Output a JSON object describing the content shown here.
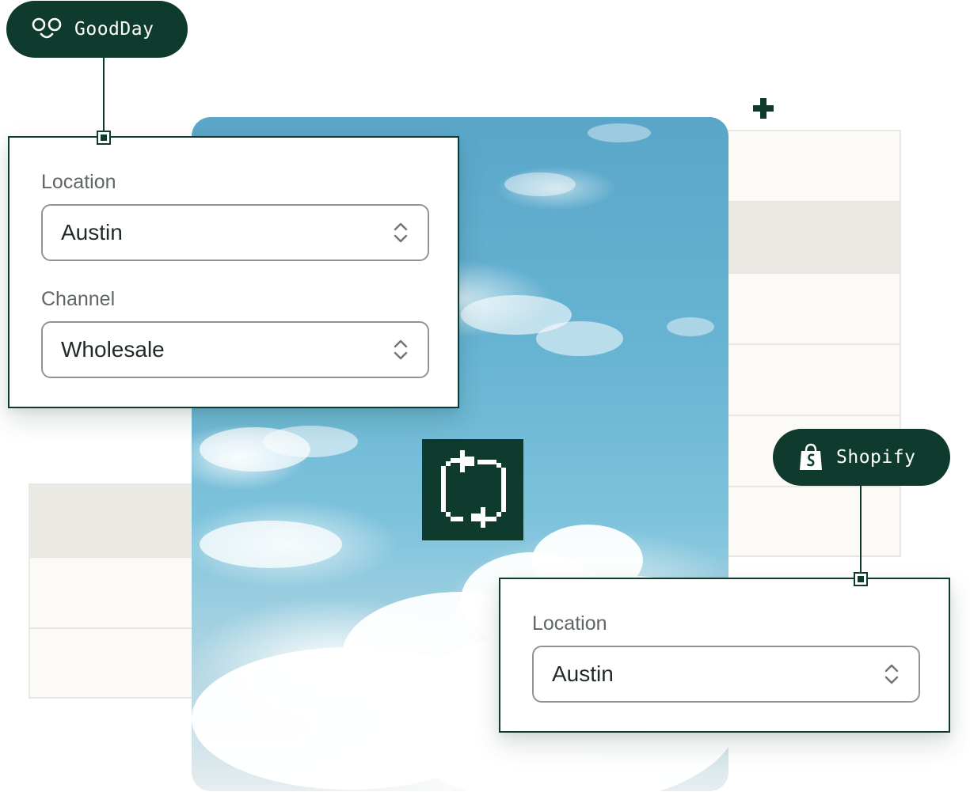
{
  "goodday": {
    "badge": {
      "label": "GoodDay",
      "icon": "goodday-face-icon"
    },
    "fields": [
      {
        "label": "Location",
        "value": "Austin"
      },
      {
        "label": "Channel",
        "value": "Wholesale"
      }
    ]
  },
  "shopify": {
    "badge": {
      "label": "Shopify",
      "icon": "shopify-bag-icon"
    },
    "fields": [
      {
        "label": "Location",
        "value": "Austin"
      }
    ]
  },
  "icons": {
    "sync": "sync-arrows-icon",
    "plus": "plus-icon",
    "select": "chevron-up-down-icon"
  },
  "colors": {
    "brand": "#0f3b2e",
    "label": "#5f6663",
    "field_border": "#8f9592",
    "grid_bg": "#fbfaf7",
    "grid_shaded": "#ebe9e4",
    "grid_line": "#e9e7e1"
  }
}
